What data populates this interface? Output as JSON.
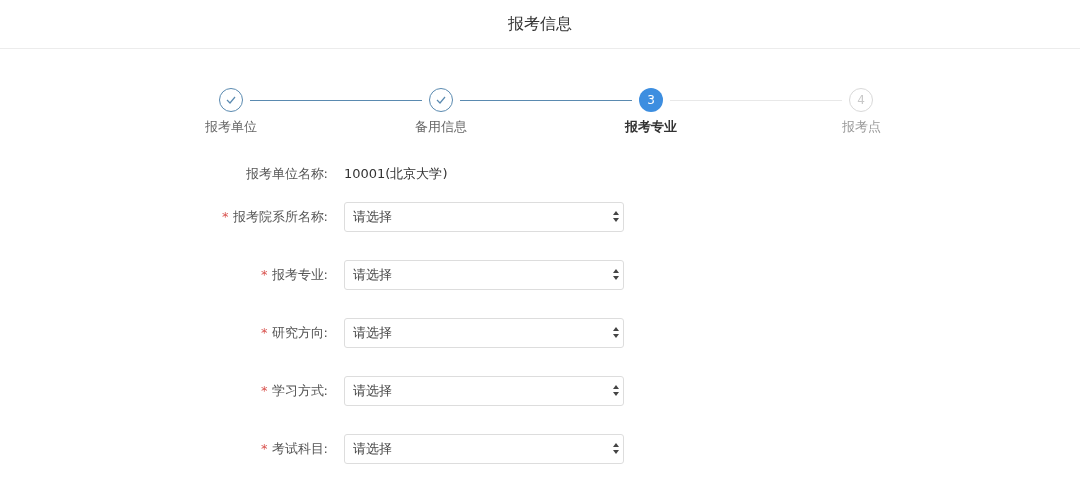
{
  "header": {
    "title": "报考信息"
  },
  "steps": [
    {
      "label": "报考单位",
      "kind": "done"
    },
    {
      "label": "备用信息",
      "kind": "done"
    },
    {
      "label": "报考专业",
      "kind": "current",
      "number": "3"
    },
    {
      "label": "报考点",
      "kind": "pending",
      "number": "4"
    }
  ],
  "form": {
    "info": {
      "label": "报考单位名称:",
      "value": "10001(北京大学)"
    },
    "fields": [
      {
        "label": "报考院系所名称:",
        "required": true,
        "placeholder": "请选择"
      },
      {
        "label": "报考专业:",
        "required": true,
        "placeholder": "请选择"
      },
      {
        "label": "研究方向:",
        "required": true,
        "placeholder": "请选择"
      },
      {
        "label": "学习方式:",
        "required": true,
        "placeholder": "请选择"
      },
      {
        "label": "考试科目:",
        "required": true,
        "placeholder": "请选择"
      }
    ],
    "required_mark": "*"
  }
}
